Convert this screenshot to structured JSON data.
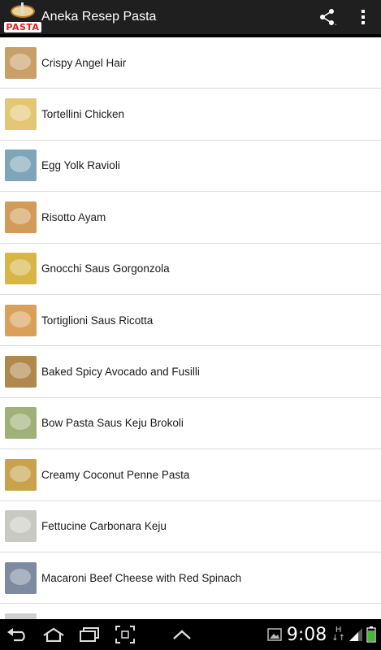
{
  "app": {
    "title": "Aneka Resep Pasta",
    "logo_text": "PASTA"
  },
  "actionbar": {
    "share_icon": "share-icon",
    "overflow_icon": "overflow-menu-icon"
  },
  "recipes": [
    {
      "label": "Crispy Angel Hair",
      "color": "#c9a06a"
    },
    {
      "label": "Tortellini Chicken",
      "color": "#e3c774"
    },
    {
      "label": "Egg Yolk Ravioli",
      "color": "#7fa6b8"
    },
    {
      "label": "Risotto Ayam",
      "color": "#d39b5a"
    },
    {
      "label": "Gnocchi Saus Gorgonzola",
      "color": "#d8b646"
    },
    {
      "label": "Tortiglioni Saus Ricotta",
      "color": "#d9a05a"
    },
    {
      "label": "Baked Spicy Avocado and Fusilli",
      "color": "#b0874c"
    },
    {
      "label": "Bow Pasta Saus Keju Brokoli",
      "color": "#9fb078"
    },
    {
      "label": "Creamy Coconut Penne Pasta",
      "color": "#c7a34c"
    },
    {
      "label": "Fettucine Carbonara Keju",
      "color": "#c9c9c4"
    },
    {
      "label": "Macaroni Beef Cheese with Red Spinach",
      "color": "#7d8aa0"
    },
    {
      "label": "",
      "color": "#cfcfcf"
    }
  ],
  "statusbar": {
    "time": "9:08",
    "net_top": "H",
    "net_bottom": "↓↑"
  }
}
